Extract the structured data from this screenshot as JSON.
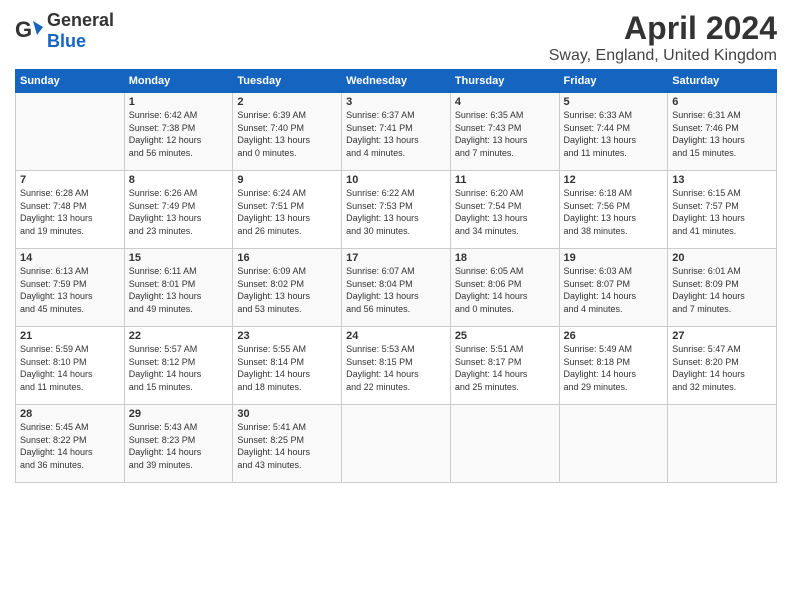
{
  "header": {
    "logo_general": "General",
    "logo_blue": "Blue",
    "month_title": "April 2024",
    "location": "Sway, England, United Kingdom"
  },
  "days_of_week": [
    "Sunday",
    "Monday",
    "Tuesday",
    "Wednesday",
    "Thursday",
    "Friday",
    "Saturday"
  ],
  "weeks": [
    [
      {
        "day": "",
        "content": ""
      },
      {
        "day": "1",
        "content": "Sunrise: 6:42 AM\nSunset: 7:38 PM\nDaylight: 12 hours\nand 56 minutes."
      },
      {
        "day": "2",
        "content": "Sunrise: 6:39 AM\nSunset: 7:40 PM\nDaylight: 13 hours\nand 0 minutes."
      },
      {
        "day": "3",
        "content": "Sunrise: 6:37 AM\nSunset: 7:41 PM\nDaylight: 13 hours\nand 4 minutes."
      },
      {
        "day": "4",
        "content": "Sunrise: 6:35 AM\nSunset: 7:43 PM\nDaylight: 13 hours\nand 7 minutes."
      },
      {
        "day": "5",
        "content": "Sunrise: 6:33 AM\nSunset: 7:44 PM\nDaylight: 13 hours\nand 11 minutes."
      },
      {
        "day": "6",
        "content": "Sunrise: 6:31 AM\nSunset: 7:46 PM\nDaylight: 13 hours\nand 15 minutes."
      }
    ],
    [
      {
        "day": "7",
        "content": "Sunrise: 6:28 AM\nSunset: 7:48 PM\nDaylight: 13 hours\nand 19 minutes."
      },
      {
        "day": "8",
        "content": "Sunrise: 6:26 AM\nSunset: 7:49 PM\nDaylight: 13 hours\nand 23 minutes."
      },
      {
        "day": "9",
        "content": "Sunrise: 6:24 AM\nSunset: 7:51 PM\nDaylight: 13 hours\nand 26 minutes."
      },
      {
        "day": "10",
        "content": "Sunrise: 6:22 AM\nSunset: 7:53 PM\nDaylight: 13 hours\nand 30 minutes."
      },
      {
        "day": "11",
        "content": "Sunrise: 6:20 AM\nSunset: 7:54 PM\nDaylight: 13 hours\nand 34 minutes."
      },
      {
        "day": "12",
        "content": "Sunrise: 6:18 AM\nSunset: 7:56 PM\nDaylight: 13 hours\nand 38 minutes."
      },
      {
        "day": "13",
        "content": "Sunrise: 6:15 AM\nSunset: 7:57 PM\nDaylight: 13 hours\nand 41 minutes."
      }
    ],
    [
      {
        "day": "14",
        "content": "Sunrise: 6:13 AM\nSunset: 7:59 PM\nDaylight: 13 hours\nand 45 minutes."
      },
      {
        "day": "15",
        "content": "Sunrise: 6:11 AM\nSunset: 8:01 PM\nDaylight: 13 hours\nand 49 minutes."
      },
      {
        "day": "16",
        "content": "Sunrise: 6:09 AM\nSunset: 8:02 PM\nDaylight: 13 hours\nand 53 minutes."
      },
      {
        "day": "17",
        "content": "Sunrise: 6:07 AM\nSunset: 8:04 PM\nDaylight: 13 hours\nand 56 minutes."
      },
      {
        "day": "18",
        "content": "Sunrise: 6:05 AM\nSunset: 8:06 PM\nDaylight: 14 hours\nand 0 minutes."
      },
      {
        "day": "19",
        "content": "Sunrise: 6:03 AM\nSunset: 8:07 PM\nDaylight: 14 hours\nand 4 minutes."
      },
      {
        "day": "20",
        "content": "Sunrise: 6:01 AM\nSunset: 8:09 PM\nDaylight: 14 hours\nand 7 minutes."
      }
    ],
    [
      {
        "day": "21",
        "content": "Sunrise: 5:59 AM\nSunset: 8:10 PM\nDaylight: 14 hours\nand 11 minutes."
      },
      {
        "day": "22",
        "content": "Sunrise: 5:57 AM\nSunset: 8:12 PM\nDaylight: 14 hours\nand 15 minutes."
      },
      {
        "day": "23",
        "content": "Sunrise: 5:55 AM\nSunset: 8:14 PM\nDaylight: 14 hours\nand 18 minutes."
      },
      {
        "day": "24",
        "content": "Sunrise: 5:53 AM\nSunset: 8:15 PM\nDaylight: 14 hours\nand 22 minutes."
      },
      {
        "day": "25",
        "content": "Sunrise: 5:51 AM\nSunset: 8:17 PM\nDaylight: 14 hours\nand 25 minutes."
      },
      {
        "day": "26",
        "content": "Sunrise: 5:49 AM\nSunset: 8:18 PM\nDaylight: 14 hours\nand 29 minutes."
      },
      {
        "day": "27",
        "content": "Sunrise: 5:47 AM\nSunset: 8:20 PM\nDaylight: 14 hours\nand 32 minutes."
      }
    ],
    [
      {
        "day": "28",
        "content": "Sunrise: 5:45 AM\nSunset: 8:22 PM\nDaylight: 14 hours\nand 36 minutes."
      },
      {
        "day": "29",
        "content": "Sunrise: 5:43 AM\nSunset: 8:23 PM\nDaylight: 14 hours\nand 39 minutes."
      },
      {
        "day": "30",
        "content": "Sunrise: 5:41 AM\nSunset: 8:25 PM\nDaylight: 14 hours\nand 43 minutes."
      },
      {
        "day": "",
        "content": ""
      },
      {
        "day": "",
        "content": ""
      },
      {
        "day": "",
        "content": ""
      },
      {
        "day": "",
        "content": ""
      }
    ]
  ]
}
